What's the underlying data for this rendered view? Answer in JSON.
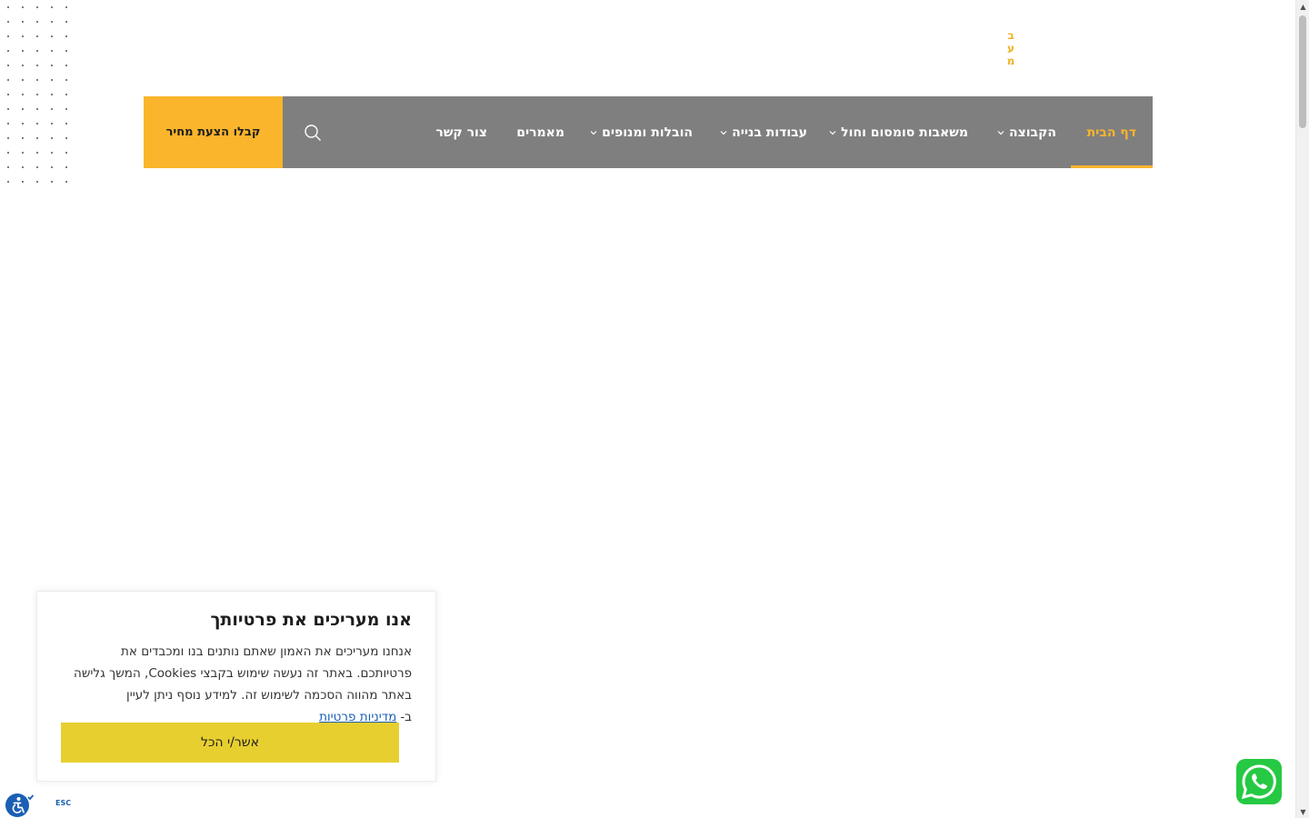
{
  "logo": {
    "chars": [
      "ב",
      "ע",
      "מ"
    ]
  },
  "nav": {
    "items": [
      {
        "label": "דף הבית",
        "has_dropdown": false,
        "active": true
      },
      {
        "label": "הקבוצה",
        "has_dropdown": true,
        "active": false
      },
      {
        "label": "משאבות סומסום וחול",
        "has_dropdown": true,
        "active": false
      },
      {
        "label": "עבודות בנייה",
        "has_dropdown": true,
        "active": false
      },
      {
        "label": "הובלות ומנופים",
        "has_dropdown": true,
        "active": false
      },
      {
        "label": "מאמרים",
        "has_dropdown": false,
        "active": false
      },
      {
        "label": "צור קשר",
        "has_dropdown": false,
        "active": false
      }
    ],
    "search_icon": "search-icon",
    "cta_label": "קבלו הצעת מחיר"
  },
  "cookie": {
    "title": "אנו מעריכים את פרטיותך",
    "body": "אנחנו מעריכים את האמון שאתם נותנים בנו ומכבדים את פרטיותכם. באתר זה נעשה שימוש בקבצי Cookies, המשך גלישה באתר מהווה הסכמה לשימוש זה. למידע נוסף ניתן לעיין ב-",
    "link": "מדיניות פרטיות",
    "accept": "אשר/י הכל"
  },
  "accessibility": {
    "icon": "accessibility-icon",
    "esc_label": "ESC"
  },
  "whatsapp": {
    "icon": "whatsapp-icon"
  },
  "colors": {
    "accent": "#fbb52c",
    "nav_bg": "#7f7f7f",
    "accept_button": "#e8cf30",
    "whatsapp": "#26c943",
    "link": "#1a5fb4"
  }
}
